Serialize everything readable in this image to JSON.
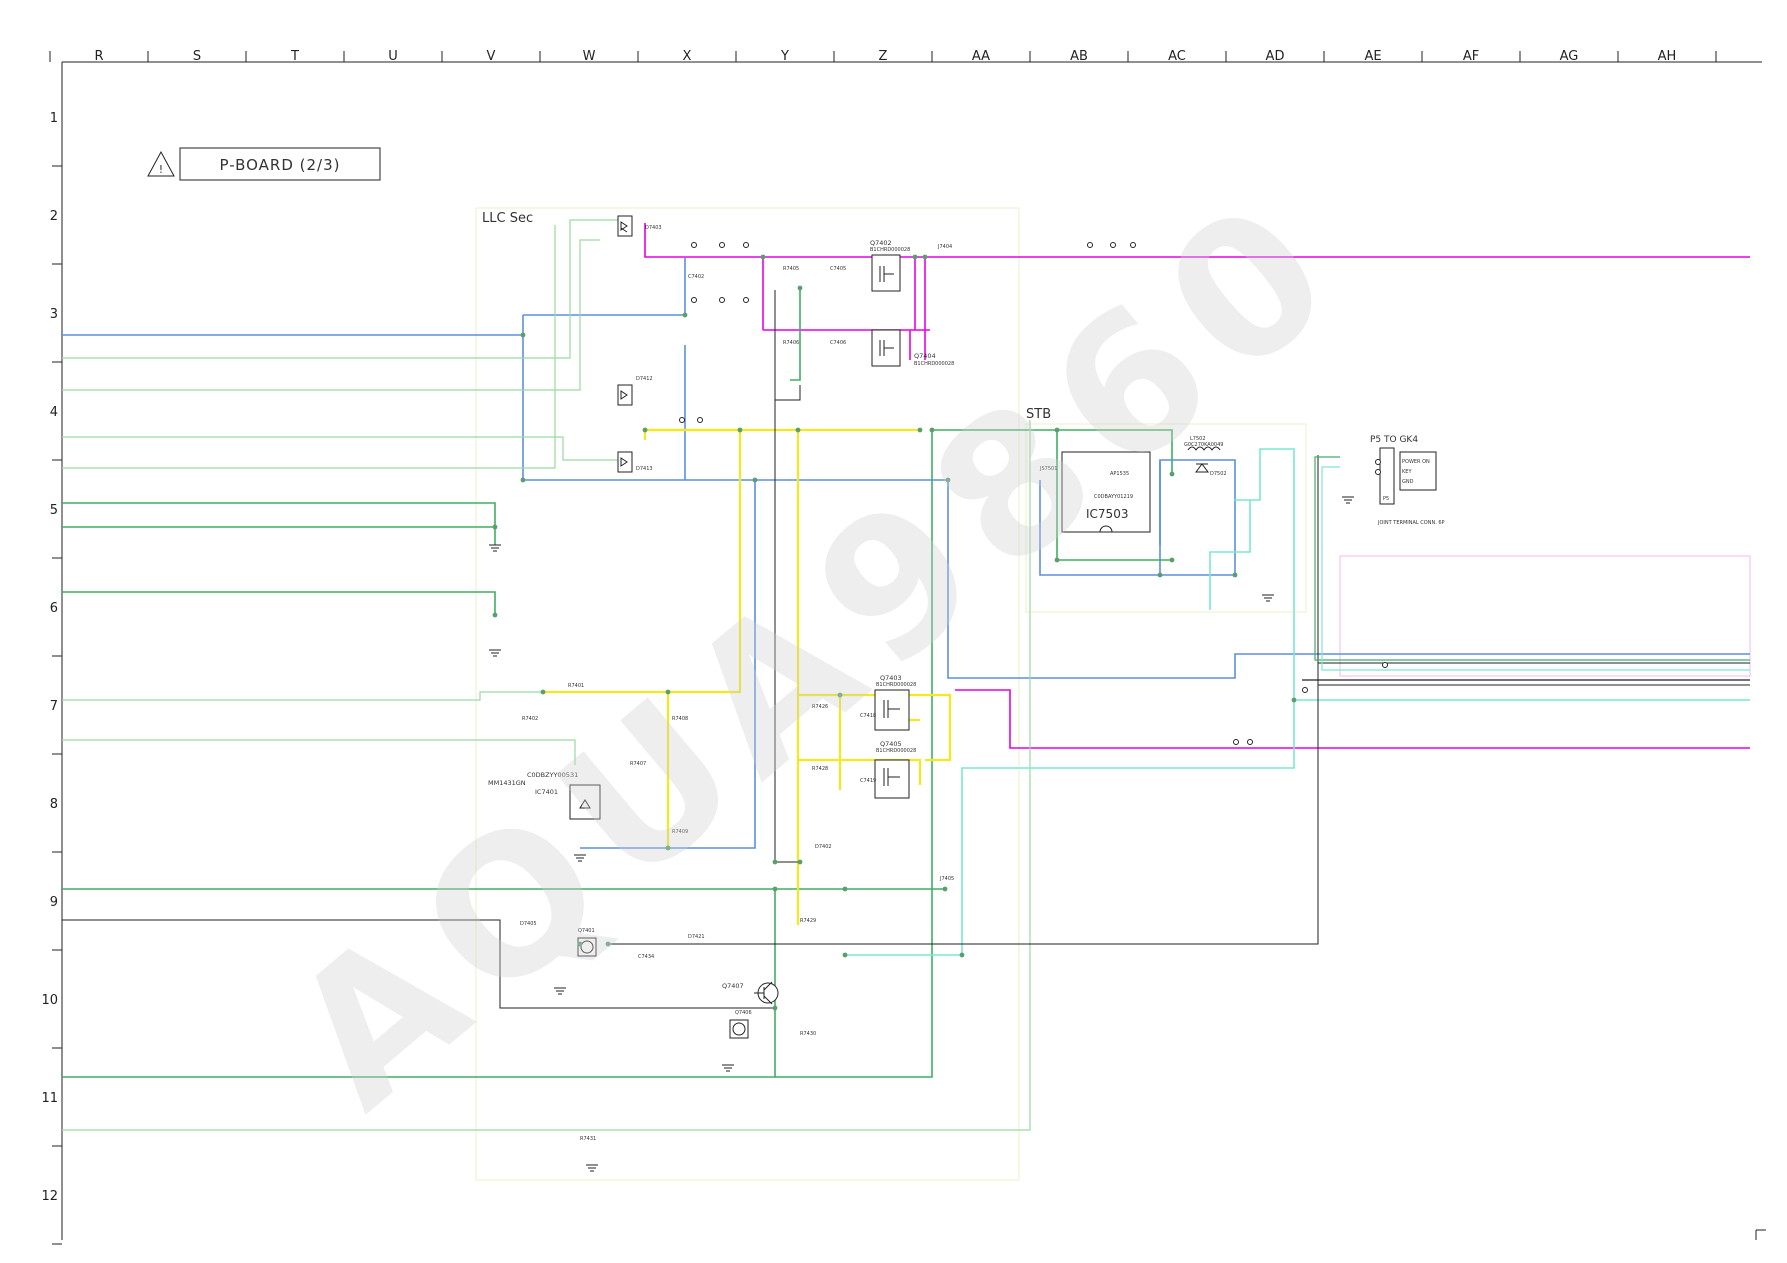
{
  "board_title": "P-BOARD (2/3)",
  "warning_symbol": "!",
  "watermark": "AQUA9860",
  "columns": [
    "R",
    "S",
    "T",
    "U",
    "V",
    "W",
    "X",
    "Y",
    "Z",
    "AA",
    "AB",
    "AC",
    "AD",
    "AE",
    "AF",
    "AG",
    "AH"
  ],
  "rows": [
    "1",
    "2",
    "3",
    "4",
    "5",
    "6",
    "7",
    "8",
    "9",
    "10",
    "11",
    "12"
  ],
  "blocks": {
    "llc": "LLC Sec",
    "stb": "STB",
    "p5": "P5  TO GK4"
  },
  "components": {
    "q7402": "Q7402",
    "q7402_pn": "B1CHRD000028",
    "q7404": "Q7404",
    "q7404_pn": "B1CHRD000028",
    "q7403": "Q7403",
    "q7403_pn": "B1CHRD000028",
    "q7405": "Q7405",
    "q7405_pn": "B1CHRD000028",
    "q7407": "Q7407",
    "q7401": "Q7401",
    "q7406": "Q7406",
    "ic7401": "IC7401",
    "ic7401_pn1": "C0DBZYY00531",
    "ic7401_pn2": "MM1431GN",
    "ic7503": "IC7503",
    "ic7503_pn": "C0DBAYY01219",
    "ic7503_chip": "AP1535",
    "l7502": "L7502",
    "l7502_pn": "G0C270KA0049",
    "d7502": "D7502",
    "d7402": "D7402",
    "d7403": "D7403",
    "d7412": "D7412",
    "d7413": "D7413",
    "d7405": "D7405",
    "d7421": "D7421",
    "c7402": "C7402",
    "c7405": "C7405",
    "c7406": "C7406",
    "c7418": "C7418",
    "c7419": "C7419",
    "c7434": "C7434",
    "r7405": "R7405",
    "r7406": "R7406",
    "r7407": "R7407",
    "r7408": "R7408",
    "r7409": "R7409",
    "r7426": "R7426",
    "r7428": "R7428",
    "r7429": "R7429",
    "r7430": "R7430",
    "r7431": "R7431",
    "r7401": "R7401",
    "r7402": "R7402",
    "j7404": "J7404",
    "j7405": "J7405",
    "js7501": "JS7501",
    "conn_pins": [
      "POWER ON",
      "KEY",
      "GND"
    ],
    "conn_name": "P5",
    "conn_note": "JOINT TERMINAL CONN. 6P"
  },
  "colors": {
    "magenta": "#e600e6",
    "blue": "#5b8fe0",
    "green": "#3fae63",
    "yellow": "#f2e91f",
    "cyan": "#7ae8d0",
    "black": "#222222",
    "light_green": "#9bd9a3"
  }
}
